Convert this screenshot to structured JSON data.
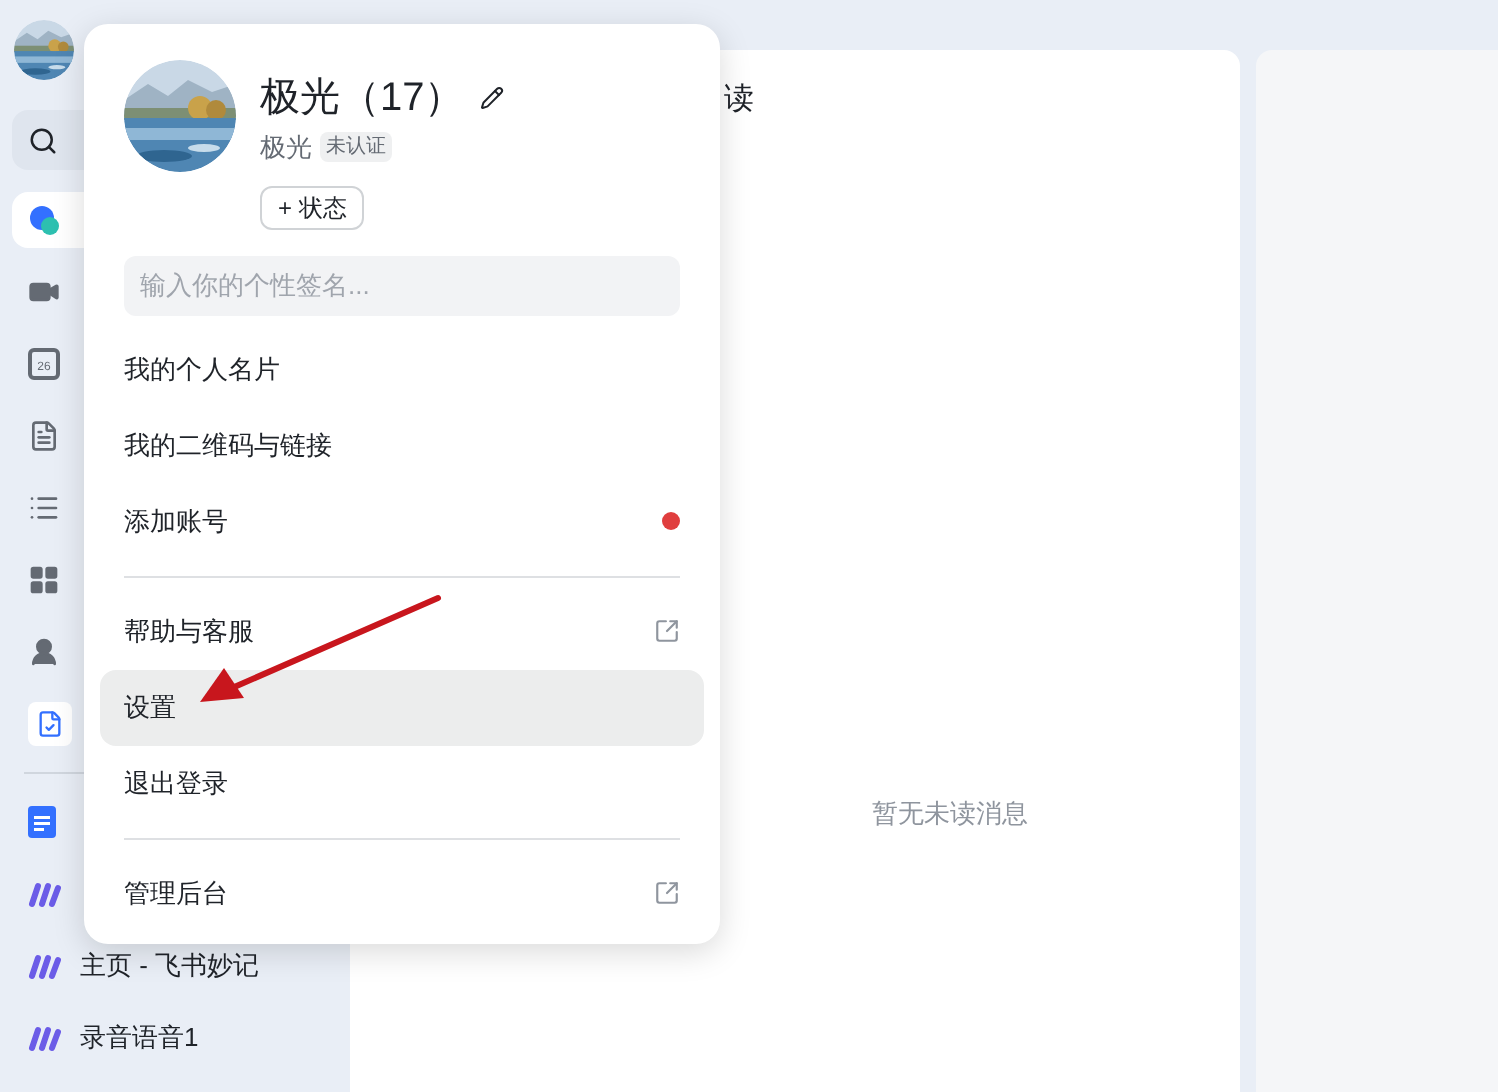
{
  "sidebar": {
    "nav_items": [
      {
        "selected": true
      },
      {
        "selected": false
      },
      {
        "selected": false,
        "icon_text": "26"
      },
      {
        "selected": false
      },
      {
        "selected": false
      },
      {
        "selected": false
      },
      {
        "selected": false
      },
      {
        "selected": false
      }
    ],
    "recent_items": [
      {
        "kind": "doc"
      },
      {
        "kind": "minutes"
      },
      {
        "kind": "minutes",
        "label": "主页 - 飞书妙记"
      },
      {
        "kind": "minutes",
        "label": "录音语音1"
      }
    ]
  },
  "main_panel": {
    "title_fragment": "读",
    "empty_message": "暂无未读消息"
  },
  "profile_menu": {
    "name": "极光（17）",
    "username": "极光",
    "badge": "未认证",
    "status_button": "+ 状态",
    "signature_placeholder": "输入你的个性签名...",
    "sections": [
      [
        {
          "label": "我的个人名片",
          "hovered": false,
          "dot": false,
          "external": false
        },
        {
          "label": "我的二维码与链接",
          "hovered": false,
          "dot": false,
          "external": false
        },
        {
          "label": "添加账号",
          "hovered": false,
          "dot": true,
          "external": false
        }
      ],
      [
        {
          "label": "帮助与客服",
          "hovered": false,
          "dot": false,
          "external": true
        },
        {
          "label": "设置",
          "hovered": true,
          "dot": false,
          "external": false
        },
        {
          "label": "退出登录",
          "hovered": false,
          "dot": false,
          "external": false
        }
      ],
      [
        {
          "label": "管理后台",
          "hovered": false,
          "dot": false,
          "external": true
        }
      ]
    ]
  }
}
